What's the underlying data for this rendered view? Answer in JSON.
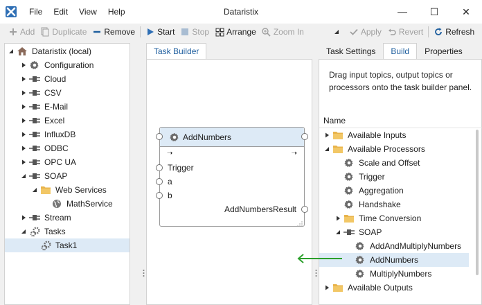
{
  "window": {
    "title": "Dataristix",
    "menu": [
      "File",
      "Edit",
      "View",
      "Help"
    ],
    "minimize_glyph": "—",
    "maximize_glyph": "☐",
    "close_glyph": "✕"
  },
  "toolbar": {
    "add": "Add",
    "duplicate": "Duplicate",
    "remove": "Remove",
    "start": "Start",
    "stop": "Stop",
    "arrange": "Arrange",
    "zoom_in": "Zoom In",
    "apply": "Apply",
    "revert": "Revert",
    "refresh": "Refresh"
  },
  "tree": {
    "root": "Dataristix (local)",
    "items": [
      {
        "label": "Configuration",
        "icon": "gear-icon"
      },
      {
        "label": "Cloud",
        "icon": "plug-icon"
      },
      {
        "label": "CSV",
        "icon": "plug-icon"
      },
      {
        "label": "E-Mail",
        "icon": "plug-icon"
      },
      {
        "label": "Excel",
        "icon": "plug-icon"
      },
      {
        "label": "InfluxDB",
        "icon": "plug-icon"
      },
      {
        "label": "ODBC",
        "icon": "plug-icon"
      },
      {
        "label": "OPC UA",
        "icon": "plug-icon"
      },
      {
        "label": "SOAP",
        "icon": "plug-icon"
      },
      {
        "label": "Web Services",
        "icon": "folder-icon"
      },
      {
        "label": "MathService",
        "icon": "globe-icon"
      },
      {
        "label": "Stream",
        "icon": "plug-icon"
      },
      {
        "label": "Tasks",
        "icon": "gears-icon"
      },
      {
        "label": "Task1",
        "icon": "gears-icon"
      }
    ]
  },
  "center": {
    "tab": "Task Builder",
    "node": {
      "title": "AddNumbers",
      "inputs": [
        "Trigger",
        "a",
        "b"
      ],
      "output": "AddNumbersResult"
    }
  },
  "right": {
    "tabs": [
      "Task Settings",
      "Build",
      "Properties"
    ],
    "hint": "Drag input topics, output topics or processors onto the task builder panel.",
    "column_header": "Name",
    "items": [
      {
        "label": "Available Inputs",
        "icon": "folder-icon"
      },
      {
        "label": "Available Processors",
        "icon": "folder-icon"
      },
      {
        "label": "Scale and Offset",
        "icon": "gear-icon"
      },
      {
        "label": "Trigger",
        "icon": "gear-icon"
      },
      {
        "label": "Aggregation",
        "icon": "gear-icon"
      },
      {
        "label": "Handshake",
        "icon": "gear-icon"
      },
      {
        "label": "Time Conversion",
        "icon": "folder-icon"
      },
      {
        "label": "SOAP",
        "icon": "plug-icon"
      },
      {
        "label": "AddAndMultiplyNumbers",
        "icon": "gear-icon"
      },
      {
        "label": "AddNumbers",
        "icon": "gear-icon"
      },
      {
        "label": "MultiplyNumbers",
        "icon": "gear-icon"
      },
      {
        "label": "Available Outputs",
        "icon": "folder-icon"
      }
    ]
  },
  "colors": {
    "accent": "#1e5e9e",
    "selection": "#ddeaf6",
    "folder": "#e8b34a",
    "drag_arrow": "#2ca02c"
  }
}
